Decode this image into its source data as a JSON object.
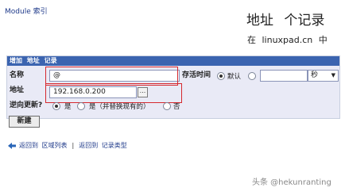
{
  "nav": {
    "module_label": "Module",
    "index_link": "索引"
  },
  "header": {
    "title": "地址 个记录",
    "subtitle": "在 linuxpad.cn 中"
  },
  "form": {
    "header_items": [
      "增加",
      "地址",
      "记录"
    ],
    "name_label": "名称",
    "name_value": "@",
    "address_label": "地址",
    "address_value": "192.168.0.200",
    "browse_label": "...",
    "ttl_label": "存活时间",
    "ttl_default_label": "默认",
    "ttl_value": "",
    "ttl_unit": "秒",
    "reverse_label": "逆向更新?",
    "reverse_options": [
      "是",
      "是（并替换现有的）",
      "否"
    ],
    "reverse_selected": 0,
    "submit_label": "新建"
  },
  "bottom": {
    "link1": "返回到 区域列表",
    "separator": "|",
    "link2": "返回到 记录类型"
  },
  "watermark": "头条 @hekunranting",
  "colors": {
    "header_bg": "#3b64b0",
    "form_bg": "#e9eaf6",
    "highlight": "#d6282e",
    "link": "#1f3a8a"
  }
}
